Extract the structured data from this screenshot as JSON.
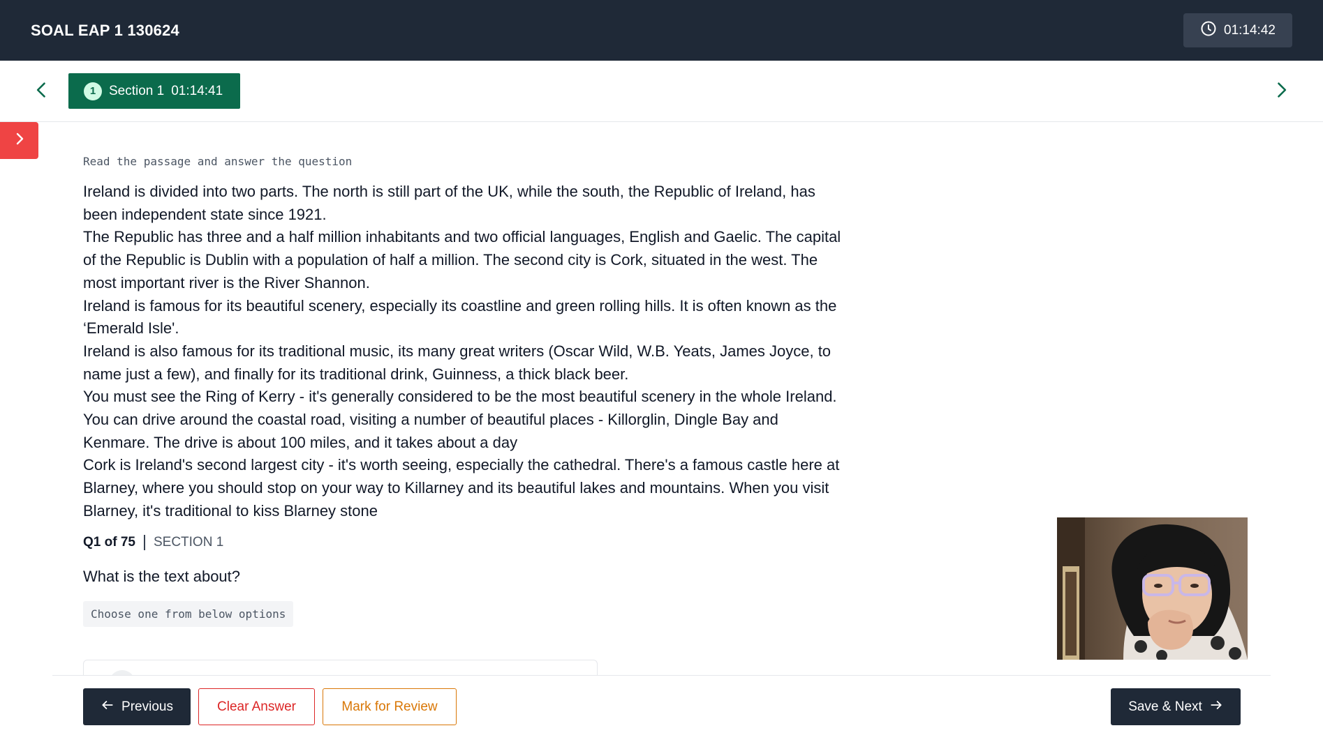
{
  "header": {
    "title": "SOAL EAP 1 130624",
    "timer": "01:14:42"
  },
  "section_bar": {
    "tab": {
      "number": "1",
      "label": "Section 1",
      "timer": "01:14:41"
    }
  },
  "content": {
    "instruction": "Read the passage and answer the question",
    "passage": [
      "Ireland is divided into two parts. The north is still part of the UK, while the south, the Republic of Ireland, has been independent state since 1921.",
      "The Republic has three and a half million inhabitants and two official languages, English and Gaelic. The capital of the Republic is Dublin with a population of half a million. The second city is Cork, situated in the west. The most important river is the River Shannon.",
      "Ireland is famous for its beautiful scenery, especially its coastline and green rolling hills. It is often known as the ‘Emerald Isle'.",
      "Ireland is also famous for its traditional music, its many great writers (Oscar Wild, W.B. Yeats, James Joyce, to name just a few), and finally for its traditional drink, Guinness, a thick black beer.",
      "You must see the Ring of Kerry - it's generally considered to be the most beautiful scenery in the whole Ireland. You can drive around the coastal road, visiting a number of beautiful places - Killorglin, Dingle Bay and Kenmare. The drive is about 100 miles, and it takes about a day",
      "Cork is Ireland's second largest city - it's worth seeing, especially the cathedral. There's a famous castle here at Blarney, where you should stop on your way to Killarney and its beautiful lakes and mountains. When you visit Blarney, it's traditional to kiss Blarney stone"
    ],
    "question_meta": {
      "number": "Q1 of 75",
      "section": "SECTION 1"
    },
    "question": "What is the text about?",
    "choose_hint": "Choose one from below options"
  },
  "footer": {
    "previous_label": "Previous",
    "clear_label": "Clear Answer",
    "review_label": "Mark for Review",
    "next_label": "Save & Next"
  },
  "colors": {
    "topbar": "#1f2937",
    "section_tab": "#0b6b4c",
    "drawer_toggle": "#ef4444",
    "clear": "#dc2626",
    "review": "#d97706",
    "nav_arrow": "#0b6b4c"
  },
  "icons": {
    "timer": "clock-icon",
    "nav_prev": "chevron-left-icon",
    "nav_next": "chevron-right-icon",
    "drawer": "chevron-right-icon",
    "previous": "arrow-left-icon",
    "next": "arrow-right-icon"
  }
}
